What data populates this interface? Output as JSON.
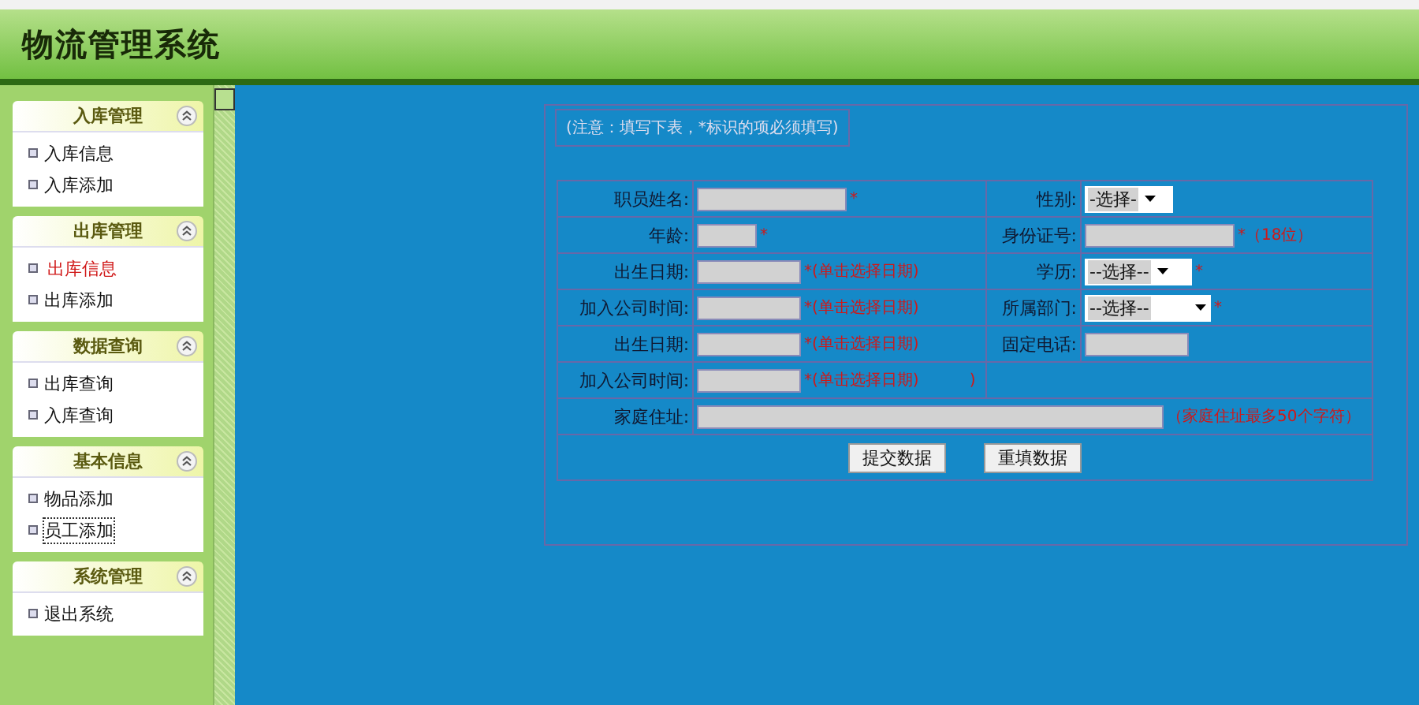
{
  "header": {
    "title": "物流管理系统"
  },
  "sidebar": {
    "groups": [
      {
        "title": "入库管理",
        "expanded": true,
        "items": [
          {
            "label": "入库信息",
            "selected": false,
            "focused": false
          },
          {
            "label": "入库添加",
            "selected": false,
            "focused": false
          }
        ]
      },
      {
        "title": "出库管理",
        "expanded": true,
        "items": [
          {
            "label": "出库信息",
            "selected": true,
            "focused": false
          },
          {
            "label": "出库添加",
            "selected": false,
            "focused": false
          }
        ]
      },
      {
        "title": "数据查询",
        "expanded": true,
        "items": [
          {
            "label": "出库查询",
            "selected": false,
            "focused": false
          },
          {
            "label": "入库查询",
            "selected": false,
            "focused": false
          }
        ]
      },
      {
        "title": "基本信息",
        "expanded": true,
        "items": [
          {
            "label": "物品添加",
            "selected": false,
            "focused": false
          },
          {
            "label": "员工添加",
            "selected": false,
            "focused": true
          }
        ]
      },
      {
        "title": "系统管理",
        "expanded": true,
        "items": [
          {
            "label": "退出系统",
            "selected": false,
            "focused": false
          }
        ]
      }
    ]
  },
  "form": {
    "notice": "(注意：填写下表，*标识的项必须填写)",
    "rows": [
      {
        "cells": [
          {
            "label": "职员姓名:",
            "kind": "input",
            "note": "*"
          },
          {
            "label": "性别:",
            "kind": "select",
            "value": "-选择-"
          }
        ]
      },
      {
        "cells": [
          {
            "label": "年龄:",
            "kind": "input",
            "note": "*"
          },
          {
            "label": "身份证号:",
            "kind": "input",
            "note": "*（18位）"
          }
        ]
      },
      {
        "cells": [
          {
            "label": "出生日期:",
            "kind": "input",
            "note": "*(单击选择日期)"
          },
          {
            "label": "学历:",
            "kind": "select",
            "value": "--选择--",
            "note": "*"
          }
        ]
      },
      {
        "cells": [
          {
            "label": "加入公司时间:",
            "kind": "input",
            "note": "*(单击选择日期)"
          },
          {
            "label": "所属部门:",
            "kind": "select",
            "value": "--选择--",
            "note": "*"
          }
        ]
      },
      {
        "cells": [
          {
            "label": "出生日期:",
            "kind": "input",
            "note": "*(单击选择日期)"
          },
          {
            "label": "固定电话:",
            "kind": "input"
          }
        ]
      },
      {
        "cells": [
          {
            "label": "加入公司时间:",
            "kind": "input",
            "note": "*(单击选择日期)",
            "extra": ")"
          },
          {
            "kind": "empty"
          }
        ]
      },
      {
        "cells": [
          {
            "label": "家庭住址:",
            "kind": "input",
            "note": "（家庭住址最多50个字符）"
          }
        ]
      }
    ],
    "buttons": [
      "提交数据",
      "重填数据"
    ]
  }
}
